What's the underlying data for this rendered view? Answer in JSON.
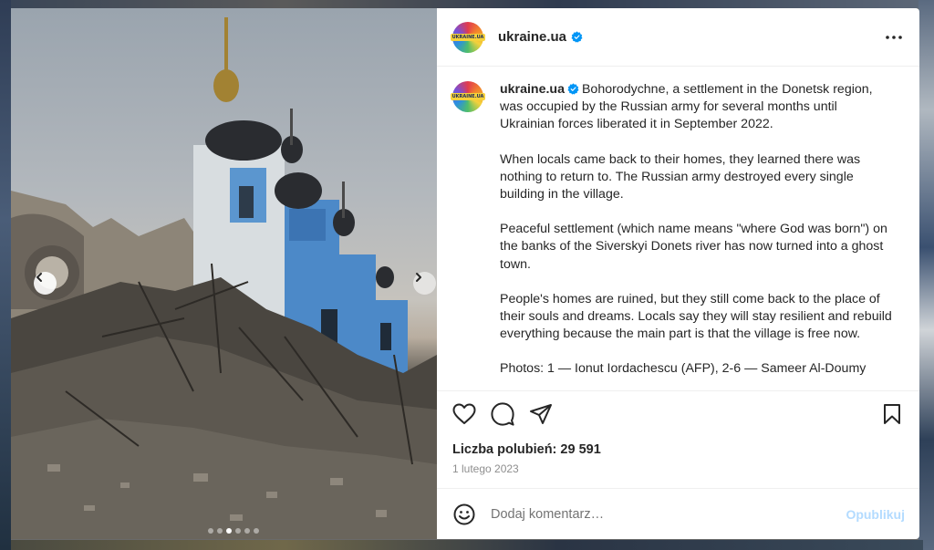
{
  "post": {
    "username": "ukraine.ua",
    "avatar_text": "UKRAINE.UA",
    "caption_paragraphs": [
      "Bohorodychne, a settlement in the Donetsk region, was occupied by the Russian army for several months until Ukrainian forces liberated it in September 2022.",
      "When locals came back to their homes, they learned there was nothing to return to. The Russian army destroyed every single building in the village.",
      "Peaceful settlement (which name means \"where God was born\") on the banks of the Siverskyi Donets river has now turned into a ghost town.",
      "People's homes are ruined, but they still come back to the place of their souls and dreams. Locals say they will stay resilient and rebuild everything because the main part is that the village is free now.",
      "Photos: 1 — Ionut Iordachescu (AFP), 2-6 — Sameer Al-Doumy"
    ],
    "likes_label": "Liczba polubień: 29 591",
    "date": "1 lutego 2023"
  },
  "carousel": {
    "total": 6,
    "active_index": 2
  },
  "comment": {
    "placeholder": "Dodaj komentarz…",
    "publish_label": "Opublikuj"
  },
  "icons": {
    "more": "more-horizontal-icon",
    "like": "heart-icon",
    "comment": "comment-bubble-icon",
    "share": "send-icon",
    "save": "bookmark-icon",
    "emoji": "emoji-smile-icon",
    "verified": "verified-badge-icon",
    "prev": "chevron-left-icon",
    "next": "chevron-right-icon"
  },
  "colors": {
    "verified": "#0095f6",
    "publish_disabled": "#b3dbff",
    "text": "#262626",
    "secondary": "#8e8e8e"
  }
}
